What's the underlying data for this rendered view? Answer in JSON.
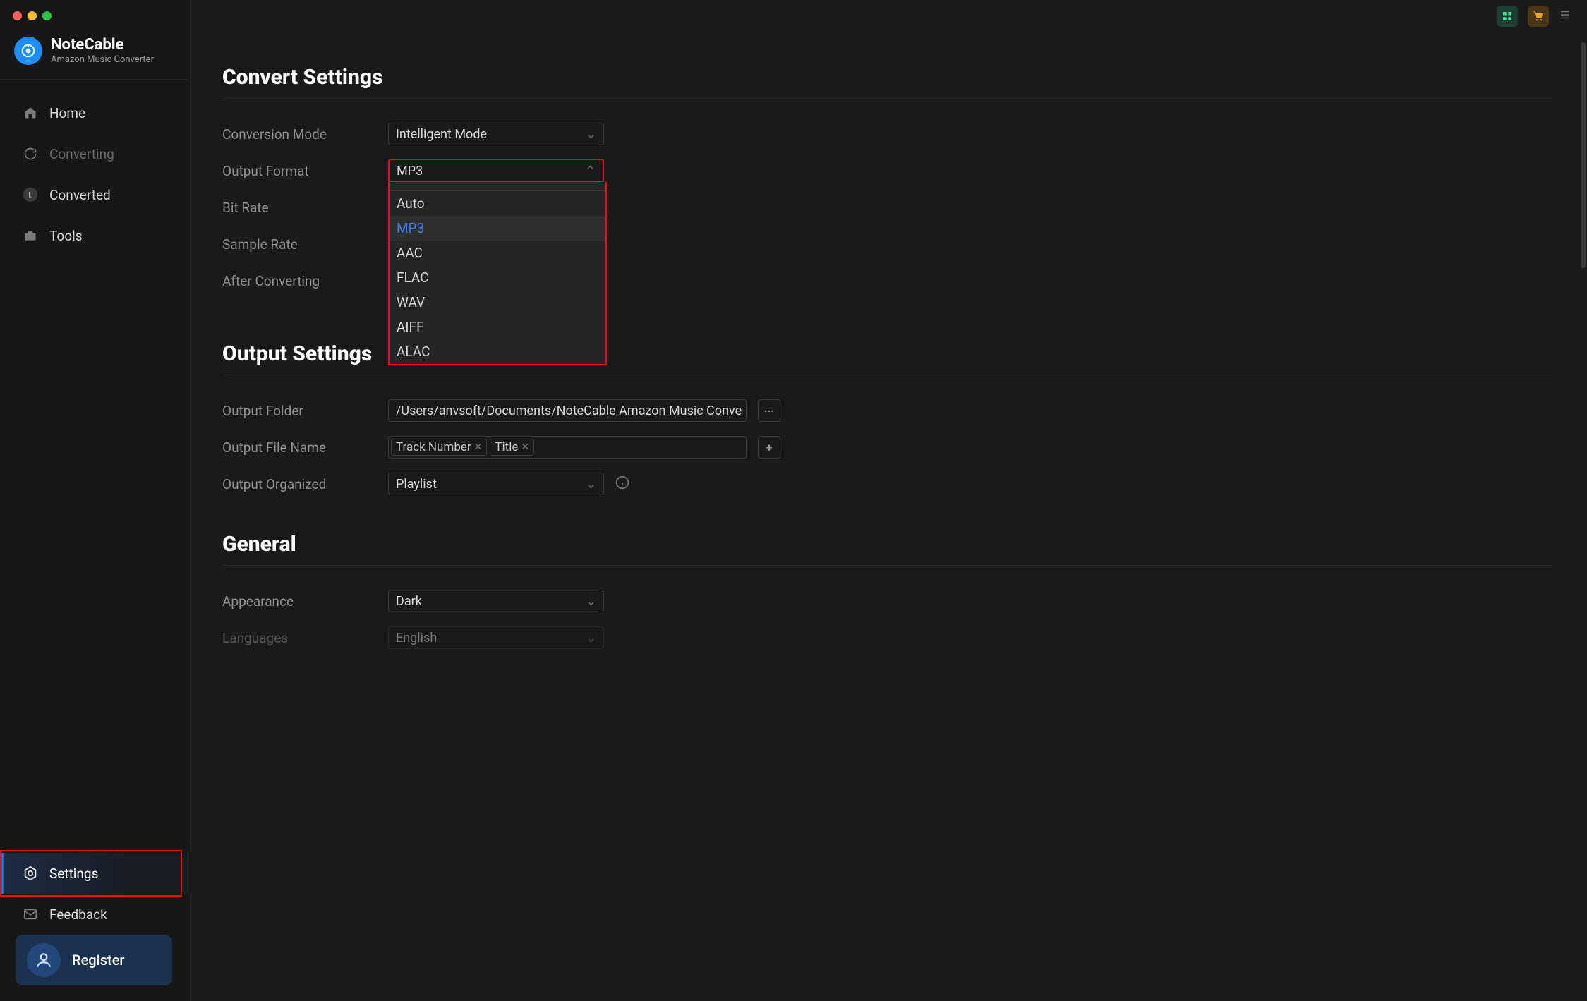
{
  "brand": {
    "title": "NoteCable",
    "subtitle": "Amazon Music Converter"
  },
  "sidebar": {
    "items": [
      {
        "label": "Home"
      },
      {
        "label": "Converting"
      },
      {
        "label": "Converted"
      },
      {
        "label": "Tools"
      }
    ],
    "settings_label": "Settings",
    "feedback_label": "Feedback",
    "register_label": "Register"
  },
  "sections": {
    "convert_settings": "Convert Settings",
    "output_settings": "Output Settings",
    "general": "General"
  },
  "convert": {
    "conversion_mode": {
      "label": "Conversion Mode",
      "value": "Intelligent Mode"
    },
    "output_format": {
      "label": "Output Format",
      "value": "MP3",
      "options": [
        "Auto",
        "MP3",
        "AAC",
        "FLAC",
        "WAV",
        "AIFF",
        "ALAC"
      ]
    },
    "bit_rate": {
      "label": "Bit Rate"
    },
    "sample_rate": {
      "label": "Sample Rate"
    },
    "after_converting": {
      "label": "After Converting"
    }
  },
  "output": {
    "folder": {
      "label": "Output Folder",
      "value": "/Users/anvsoft/Documents/NoteCable Amazon Music Conve"
    },
    "filename": {
      "label": "Output File Name",
      "tags": [
        "Track Number",
        "Title"
      ]
    },
    "organized": {
      "label": "Output Organized",
      "value": "Playlist"
    }
  },
  "general": {
    "appearance": {
      "label": "Appearance",
      "value": "Dark"
    },
    "languages": {
      "label": "Languages",
      "value": "English"
    }
  },
  "icons": {
    "browse": "···",
    "plus": "+"
  }
}
